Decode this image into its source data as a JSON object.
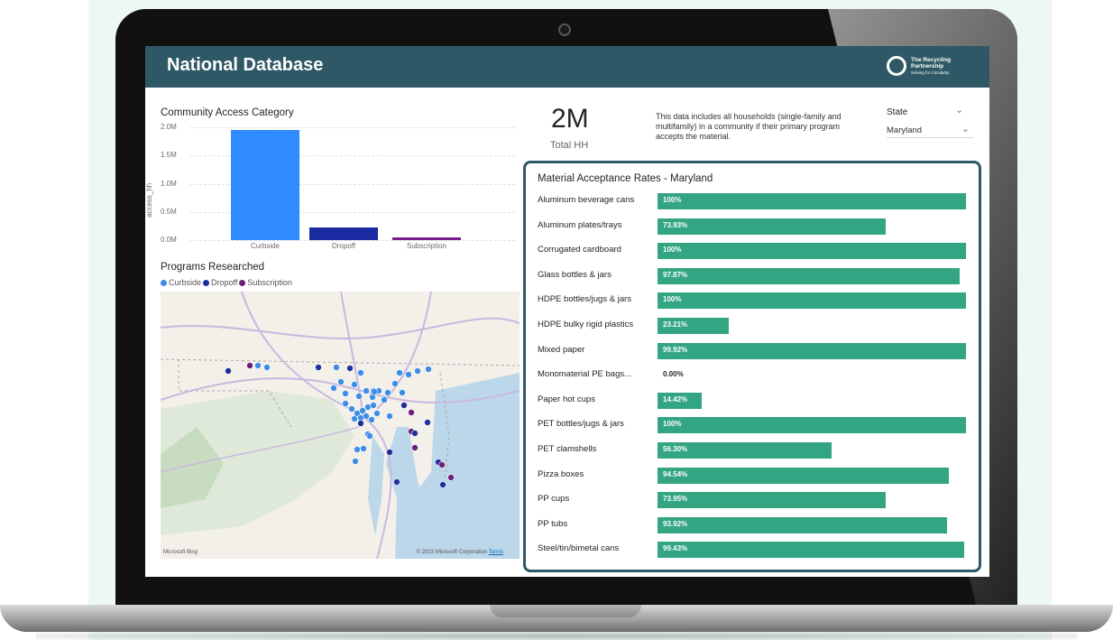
{
  "header": {
    "title": "National Database",
    "logo_text": [
      "The Recycling",
      "Partnership"
    ],
    "logo_tagline": "Solving for Circularity"
  },
  "access_chart": {
    "title": "Community Access Category",
    "y_axis_label": "access_hh",
    "y_ticks": [
      "2.0M",
      "1.5M",
      "1.0M",
      "0.5M",
      "0.0M"
    ]
  },
  "chart_data": {
    "type": "bar",
    "title": "Community Access Category",
    "categories": [
      "Curbside",
      "Dropoff",
      "Subscription"
    ],
    "values": [
      1960000,
      220000,
      45000
    ],
    "ylabel": "access_hh",
    "ylim": [
      0,
      2000000
    ],
    "colors": [
      "#2f8bff",
      "#1a2aa0",
      "#7a1c8a"
    ],
    "grid": true
  },
  "programs": {
    "title": "Programs Researched",
    "legend": [
      {
        "label": "Curbside",
        "color": "#3d8de6"
      },
      {
        "label": "Dropoff",
        "color": "#1f2f9e"
      },
      {
        "label": "Subscription",
        "color": "#6b1f7a"
      }
    ],
    "map_brand": "Microsoft Bing",
    "map_copyright": "© 2023 Microsoft Corporation",
    "map_terms": "Terms"
  },
  "kpi": {
    "value": "2M",
    "label": "Total HH",
    "note": "This data includes all households (single-family and multifamily) in a community if their primary program accepts the material."
  },
  "slicer": {
    "title": "State",
    "selected": "Maryland"
  },
  "materials": {
    "title": "Material Acceptance Rates - Maryland",
    "bar_color": "#33a583",
    "rows": [
      {
        "label": "Aluminum beverage cans",
        "value": 100,
        "display": "100%"
      },
      {
        "label": "Aluminum plates/trays",
        "value": 73.93,
        "display": "73.93%"
      },
      {
        "label": "Corrugated cardboard",
        "value": 100,
        "display": "100%"
      },
      {
        "label": "Glass bottles & jars",
        "value": 97.87,
        "display": "97.87%"
      },
      {
        "label": "HDPE bottles/jugs & jars",
        "value": 100,
        "display": "100%"
      },
      {
        "label": "HDPE bulky rigid plastics",
        "value": 23.21,
        "display": "23.21%"
      },
      {
        "label": "Mixed paper",
        "value": 99.92,
        "display": "99.92%"
      },
      {
        "label": "Monomaterial PE bags...",
        "value": 0,
        "display": "0.00%"
      },
      {
        "label": "Paper hot cups",
        "value": 14.42,
        "display": "14.42%"
      },
      {
        "label": "PET bottles/jugs & jars",
        "value": 100,
        "display": "100%"
      },
      {
        "label": "PET clamshells",
        "value": 56.3,
        "display": "56.30%"
      },
      {
        "label": "Pizza boxes",
        "value": 94.54,
        "display": "94.54%"
      },
      {
        "label": "PP cups",
        "value": 73.95,
        "display": "73.95%"
      },
      {
        "label": "PP tubs",
        "value": 93.92,
        "display": "93.92%"
      },
      {
        "label": "Steel/tin/bimetal cans",
        "value": 99.43,
        "display": "99.43%"
      }
    ]
  }
}
